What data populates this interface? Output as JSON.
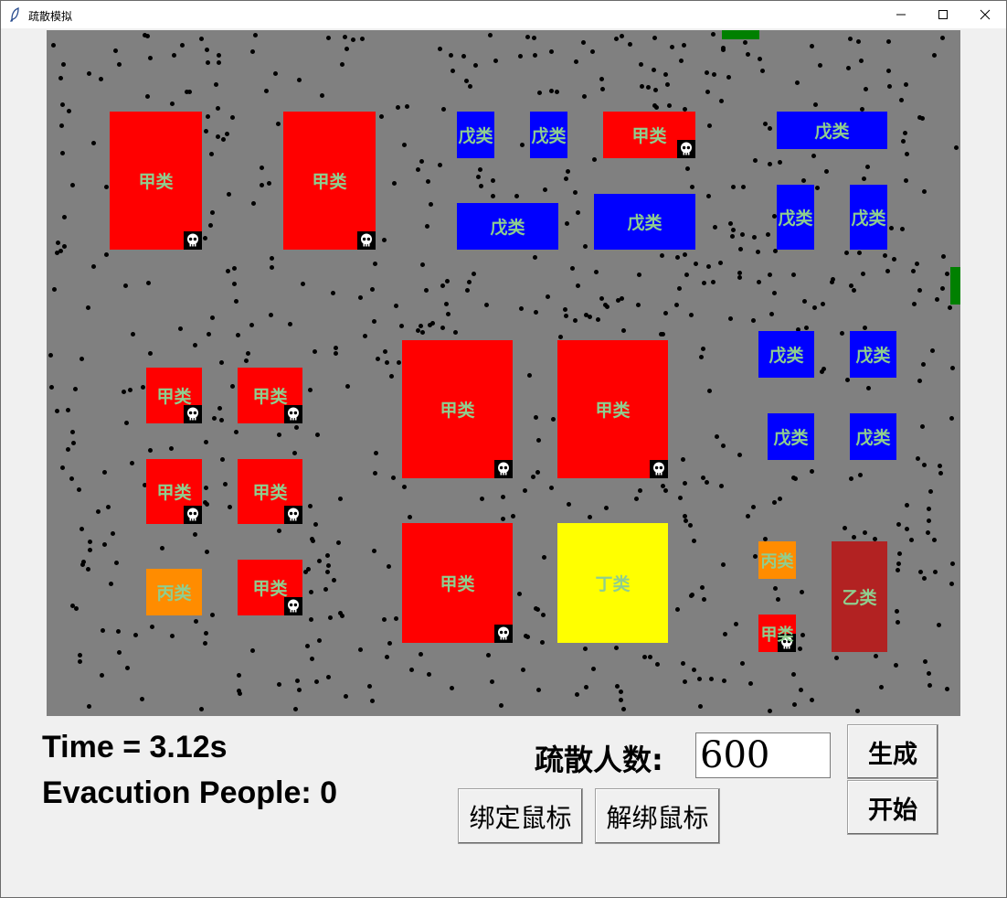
{
  "window": {
    "title": "疏散模拟"
  },
  "map": {
    "buildings": [
      {
        "label": "甲类",
        "type": "jia",
        "skull": true
      },
      {
        "label": "甲类",
        "type": "jia",
        "skull": true
      },
      {
        "label": "戊类",
        "type": "wu",
        "skull": false
      },
      {
        "label": "戊类",
        "type": "wu",
        "skull": false
      },
      {
        "label": "甲类",
        "type": "jia",
        "skull": true
      },
      {
        "label": "戊类",
        "type": "wu",
        "skull": false
      },
      {
        "label": "戊类",
        "type": "wu",
        "skull": false
      },
      {
        "label": "戊类",
        "type": "wu",
        "skull": false
      },
      {
        "label": "戊类",
        "type": "wu",
        "skull": false
      },
      {
        "label": "戊类",
        "type": "wu",
        "skull": false
      },
      {
        "label": "甲类",
        "type": "jia",
        "skull": true
      },
      {
        "label": "甲类",
        "type": "jia",
        "skull": true
      },
      {
        "label": "甲类",
        "type": "jia",
        "skull": true
      },
      {
        "label": "甲类",
        "type": "jia",
        "skull": true
      },
      {
        "label": "戊类",
        "type": "wu",
        "skull": false
      },
      {
        "label": "戊类",
        "type": "wu",
        "skull": false
      },
      {
        "label": "戊类",
        "type": "wu",
        "skull": false
      },
      {
        "label": "戊类",
        "type": "wu",
        "skull": false
      },
      {
        "label": "甲类",
        "type": "jia",
        "skull": true
      },
      {
        "label": "甲类",
        "type": "jia",
        "skull": true
      },
      {
        "label": "丙类",
        "type": "bing",
        "skull": false
      },
      {
        "label": "甲类",
        "type": "jia",
        "skull": true
      },
      {
        "label": "甲类",
        "type": "jia",
        "skull": true
      },
      {
        "label": "丁类",
        "type": "ding",
        "skull": false
      },
      {
        "label": "丙类",
        "type": "bing",
        "skull": false
      },
      {
        "label": "乙类",
        "type": "yi",
        "skull": false
      },
      {
        "label": "甲类",
        "type": "jia",
        "skull": true
      }
    ],
    "type_colors": {
      "jia": "#ff0000",
      "yi": "#b22222",
      "bing": "#ff8c00",
      "ding": "#ffff00",
      "wu": "#0000ff",
      "label_text": "#8fce8f",
      "ground": "#808080",
      "exit": "#008000",
      "person": "#000000"
    }
  },
  "status": {
    "time_text": "Time = 3.12s",
    "evac_text": "Evacution People: 0"
  },
  "controls": {
    "count_label": "疏散人数:",
    "count_value": "600",
    "generate_label": "生成",
    "start_label": "开始",
    "bind_mouse_label": "绑定鼠标",
    "unbind_mouse_label": "解绑鼠标"
  }
}
